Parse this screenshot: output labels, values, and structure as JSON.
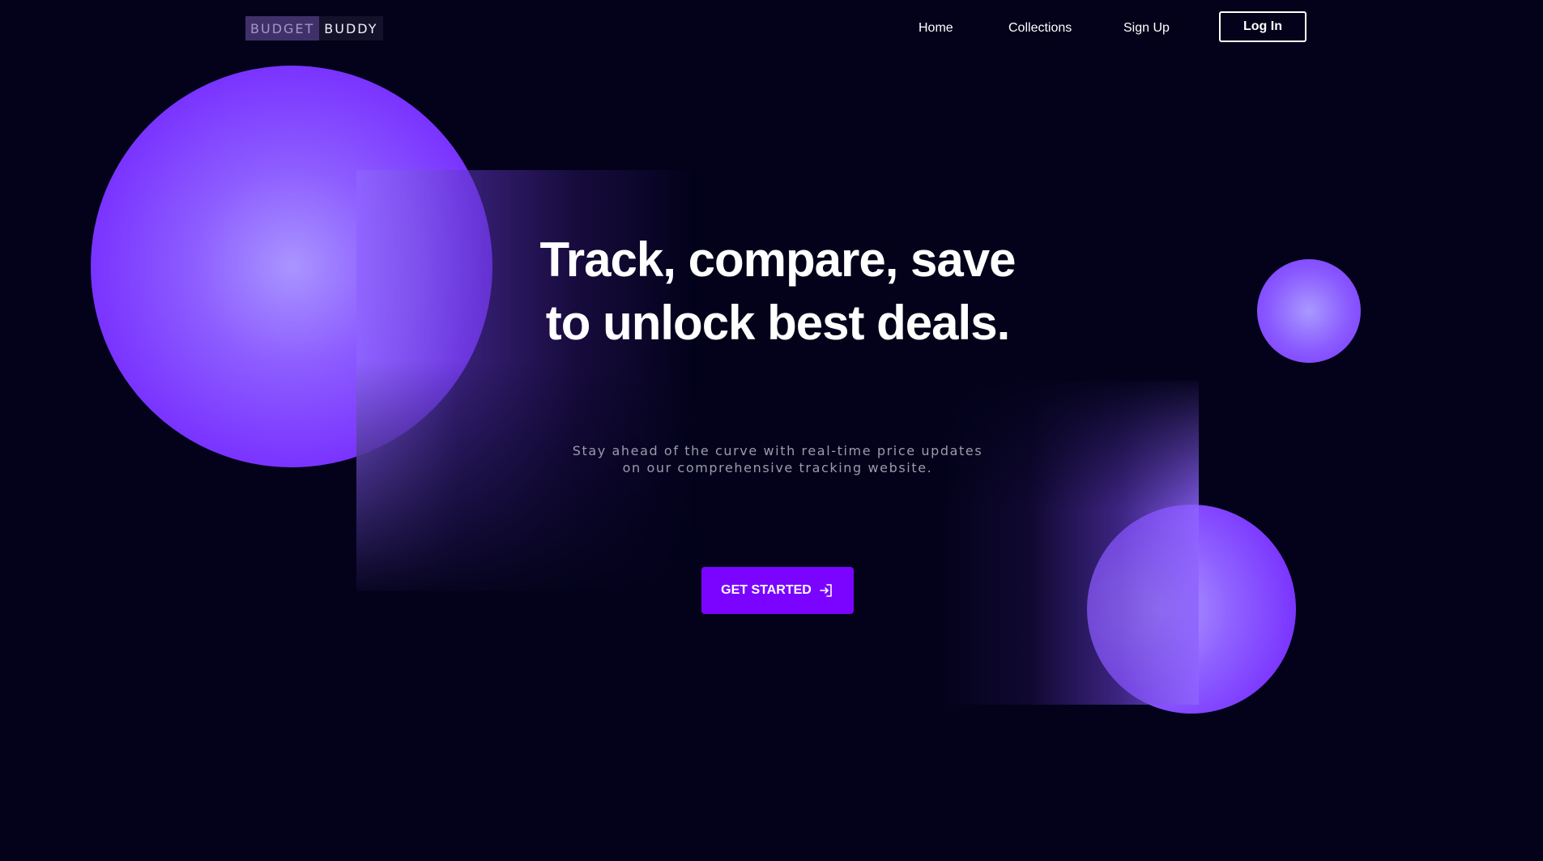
{
  "header": {
    "logo": {
      "part_a": "BUDGET",
      "part_b": "BUDDY"
    },
    "nav": {
      "home": "Home",
      "collections": "Collections",
      "sign_up": "Sign Up",
      "log_in": "Log In"
    }
  },
  "hero": {
    "title": "Track, compare, save to unlock best deals.",
    "subtitle_line_1": "Stay ahead of the curve with real-time price updates",
    "subtitle_line_2": "on our comprehensive tracking website.",
    "cta_label": "GET STARTED",
    "cta_icon": "login-arrow-icon"
  },
  "colors": {
    "background": "#03021a",
    "accent": "#7a04ff",
    "sphere": "#7a34ff",
    "subtitle": "#9c9aac"
  }
}
